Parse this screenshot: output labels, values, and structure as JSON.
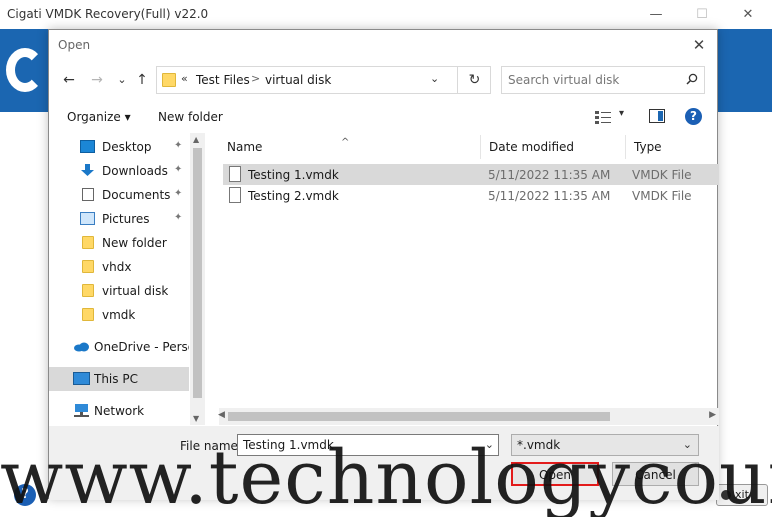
{
  "app": {
    "title": "Cigati VMDK Recovery(Full) v22.0",
    "controls": {
      "minimize": "—",
      "maximize": "☐",
      "close": "✕"
    },
    "help_label": "?",
    "exit_label": "xit"
  },
  "dialog": {
    "title": "Open",
    "close_glyph": "✕",
    "nav": {
      "back": "←",
      "forward": "→",
      "recent": "⌄",
      "up": "↑"
    },
    "address": {
      "chevron": "«",
      "segments": [
        "Test Files",
        "virtual disk"
      ],
      "separator": ">",
      "dropdown": "⌄",
      "refresh": "↻"
    },
    "search": {
      "placeholder": "Search virtual disk"
    },
    "toolbar": {
      "organize_label": "Organize ▾",
      "new_folder_label": "New folder",
      "view_dropdown": "▾",
      "help_label": "?"
    },
    "nav_pane": {
      "items": [
        {
          "label": "Desktop",
          "icon": "desktop-icon",
          "pinned": true
        },
        {
          "label": "Downloads",
          "icon": "download-icon",
          "pinned": true
        },
        {
          "label": "Documents",
          "icon": "document-icon",
          "pinned": true
        },
        {
          "label": "Pictures",
          "icon": "pictures-icon",
          "pinned": true
        },
        {
          "label": "New folder",
          "icon": "folder-icon",
          "pinned": false
        },
        {
          "label": "vhdx",
          "icon": "folder-icon",
          "pinned": false
        },
        {
          "label": "virtual disk",
          "icon": "folder-icon",
          "pinned": false
        },
        {
          "label": "vmdk",
          "icon": "folder-icon",
          "pinned": false
        },
        {
          "label": "OneDrive - Persor",
          "icon": "cloud-icon",
          "pinned": false
        },
        {
          "label": "This PC",
          "icon": "computer-icon",
          "pinned": false
        },
        {
          "label": "Network",
          "icon": "network-icon",
          "pinned": false
        }
      ],
      "pin_glyph": "📌"
    },
    "file_list": {
      "columns": [
        "Name",
        "Date modified",
        "Type"
      ],
      "sort_glyph": "^",
      "rows": [
        {
          "name": "Testing 1.vmdk",
          "date": "5/11/2022 11:35 AM",
          "type": "VMDK File",
          "selected": true
        },
        {
          "name": "Testing 2.vmdk",
          "date": "5/11/2022 11:35 AM",
          "type": "VMDK File",
          "selected": false
        }
      ]
    },
    "bottom": {
      "file_name_label": "File name:",
      "file_name_value": "Testing 1.vmdk",
      "file_type_value": "*.vmdk",
      "dropdown": "⌄",
      "open_label": "Open",
      "cancel_label": "Cancel"
    }
  },
  "watermark": {
    "text": "www.technologycounter.com"
  },
  "colors": {
    "brand_blue": "#1b66b1",
    "highlight_red": "#e31b1b",
    "selection_gray": "#d9d9d9"
  }
}
